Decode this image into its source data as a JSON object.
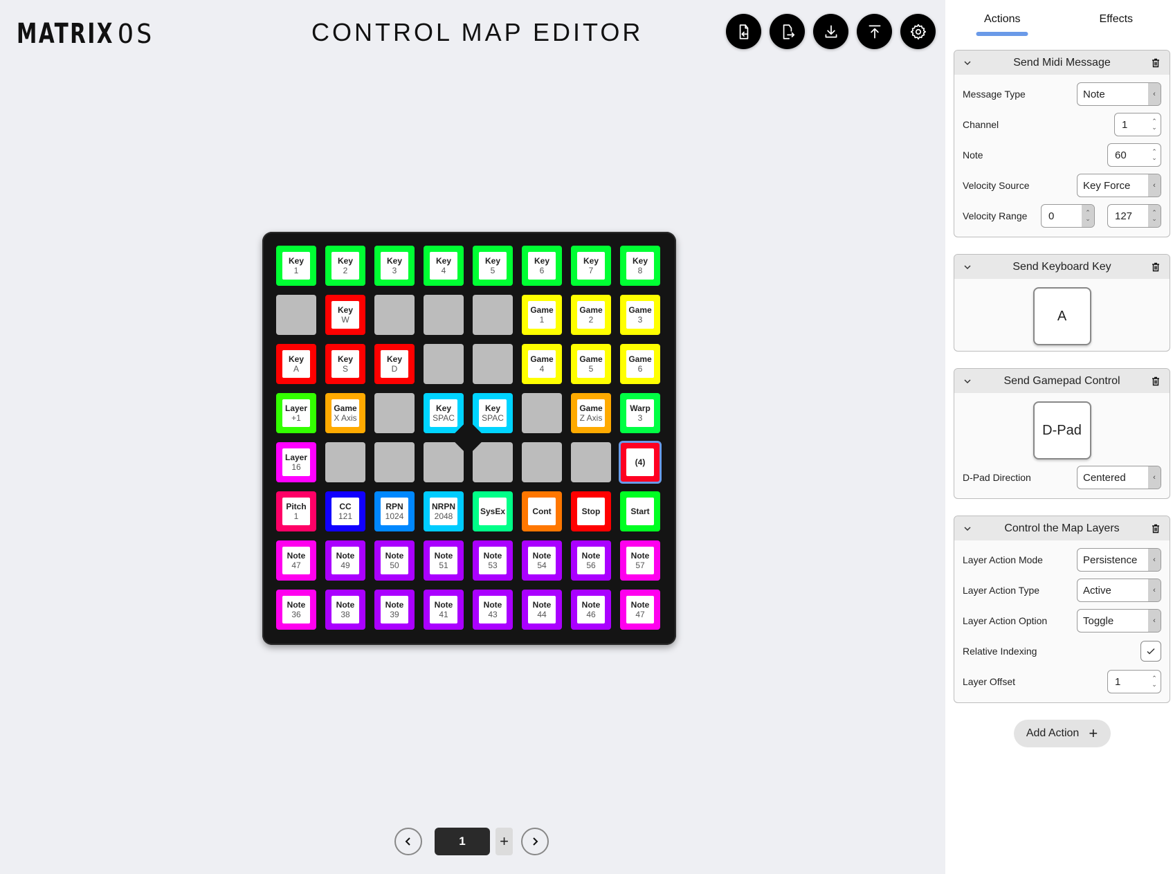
{
  "header": {
    "logo_bold": "MATRIX",
    "logo_thin": "OS",
    "title": "CONTROL MAP EDITOR",
    "toolbar": [
      {
        "name": "import-file-button",
        "icon": "file-import-icon"
      },
      {
        "name": "export-file-button",
        "icon": "file-export-icon"
      },
      {
        "name": "download-button",
        "icon": "download-icon"
      },
      {
        "name": "upload-button",
        "icon": "upload-icon"
      },
      {
        "name": "settings-button",
        "icon": "gear-icon"
      }
    ]
  },
  "grid": {
    "rows": [
      [
        {
          "l1": "Key",
          "l2": "1",
          "color": "#00ff33"
        },
        {
          "l1": "Key",
          "l2": "2",
          "color": "#00ff33"
        },
        {
          "l1": "Key",
          "l2": "3",
          "color": "#00ff33"
        },
        {
          "l1": "Key",
          "l2": "4",
          "color": "#00ff33"
        },
        {
          "l1": "Key",
          "l2": "5",
          "color": "#00ff33"
        },
        {
          "l1": "Key",
          "l2": "6",
          "color": "#00ff33"
        },
        {
          "l1": "Key",
          "l2": "7",
          "color": "#00ff33"
        },
        {
          "l1": "Key",
          "l2": "8",
          "color": "#00ff33"
        }
      ],
      [
        {
          "empty": true
        },
        {
          "l1": "Key",
          "l2": "W",
          "color": "#ff0000"
        },
        {
          "empty": true
        },
        {
          "empty": true
        },
        {
          "empty": true
        },
        {
          "l1": "Game",
          "l2": "1",
          "color": "#ffff00"
        },
        {
          "l1": "Game",
          "l2": "2",
          "color": "#ffff00"
        },
        {
          "l1": "Game",
          "l2": "3",
          "color": "#ffff00"
        }
      ],
      [
        {
          "l1": "Key",
          "l2": "A",
          "color": "#ff0000"
        },
        {
          "l1": "Key",
          "l2": "S",
          "color": "#ff0000"
        },
        {
          "l1": "Key",
          "l2": "D",
          "color": "#ff0000"
        },
        {
          "empty": true
        },
        {
          "empty": true
        },
        {
          "l1": "Game",
          "l2": "4",
          "color": "#ffff00"
        },
        {
          "l1": "Game",
          "l2": "5",
          "color": "#ffff00"
        },
        {
          "l1": "Game",
          "l2": "6",
          "color": "#ffff00"
        }
      ],
      [
        {
          "l1": "Layer",
          "l2": "+1",
          "color": "#33ff00"
        },
        {
          "l1": "Game",
          "l2": "X Axis",
          "color": "#ffaa00"
        },
        {
          "empty": true
        },
        {
          "l1": "Key",
          "l2": "SPAC",
          "color": "#00d4ff",
          "cut": "br"
        },
        {
          "l1": "Key",
          "l2": "SPAC",
          "color": "#00d4ff",
          "cut": "bl"
        },
        {
          "empty": true
        },
        {
          "l1": "Game",
          "l2": "Z Axis",
          "color": "#ffaa00"
        },
        {
          "l1": "Warp",
          "l2": "3",
          "color": "#00ff44"
        }
      ],
      [
        {
          "l1": "Layer",
          "l2": "16",
          "color": "#ff00ff"
        },
        {
          "empty": true
        },
        {
          "empty": true
        },
        {
          "empty": true,
          "cut": "tr"
        },
        {
          "empty": true,
          "cut": "tl"
        },
        {
          "empty": true
        },
        {
          "empty": true
        },
        {
          "l1": "(4)",
          "l2": "",
          "color": "#ff0022",
          "selected": true
        }
      ],
      [
        {
          "l1": "Pitch",
          "l2": "1",
          "color": "#ff0066"
        },
        {
          "l1": "CC",
          "l2": "121",
          "color": "#1100ff"
        },
        {
          "l1": "RPN",
          "l2": "1024",
          "color": "#0088ff"
        },
        {
          "l1": "NRPN",
          "l2": "2048",
          "color": "#00ccff"
        },
        {
          "l1": "SysEx",
          "l2": "",
          "color": "#00ff88"
        },
        {
          "l1": "Cont",
          "l2": "",
          "color": "#ff7700"
        },
        {
          "l1": "Stop",
          "l2": "",
          "color": "#ff0000"
        },
        {
          "l1": "Start",
          "l2": "",
          "color": "#00ff22"
        }
      ],
      [
        {
          "l1": "Note",
          "l2": "47",
          "color": "#ff00ee"
        },
        {
          "l1": "Note",
          "l2": "49",
          "color": "#aa00ff"
        },
        {
          "l1": "Note",
          "l2": "50",
          "color": "#aa00ff"
        },
        {
          "l1": "Note",
          "l2": "51",
          "color": "#aa00ff"
        },
        {
          "l1": "Note",
          "l2": "53",
          "color": "#aa00ff"
        },
        {
          "l1": "Note",
          "l2": "54",
          "color": "#aa00ff"
        },
        {
          "l1": "Note",
          "l2": "56",
          "color": "#aa00ff"
        },
        {
          "l1": "Note",
          "l2": "57",
          "color": "#ff00ee"
        }
      ],
      [
        {
          "l1": "Note",
          "l2": "36",
          "color": "#ff00ee"
        },
        {
          "l1": "Note",
          "l2": "38",
          "color": "#aa00ff"
        },
        {
          "l1": "Note",
          "l2": "39",
          "color": "#aa00ff"
        },
        {
          "l1": "Note",
          "l2": "41",
          "color": "#aa00ff"
        },
        {
          "l1": "Note",
          "l2": "43",
          "color": "#aa00ff"
        },
        {
          "l1": "Note",
          "l2": "44",
          "color": "#aa00ff"
        },
        {
          "l1": "Note",
          "l2": "46",
          "color": "#aa00ff"
        },
        {
          "l1": "Note",
          "l2": "47",
          "color": "#ff00ee"
        }
      ]
    ]
  },
  "pager": {
    "current": "1",
    "add_label": "+"
  },
  "panel": {
    "tabs": [
      {
        "label": "Actions",
        "active": true
      },
      {
        "label": "Effects",
        "active": false
      }
    ],
    "midi": {
      "title": "Send Midi Message",
      "message_type_label": "Message Type",
      "message_type_value": "Note",
      "channel_label": "Channel",
      "channel_value": "1",
      "note_label": "Note",
      "note_value": "60",
      "velocity_source_label": "Velocity Source",
      "velocity_source_value": "Key Force",
      "velocity_range_label": "Velocity Range",
      "velocity_min": "0",
      "velocity_max": "127"
    },
    "keyboard": {
      "title": "Send Keyboard Key",
      "key": "A"
    },
    "gamepad": {
      "title": "Send Gamepad Control",
      "control": "D-Pad",
      "direction_label": "D-Pad Direction",
      "direction_value": "Centered"
    },
    "layers": {
      "title": "Control the Map Layers",
      "mode_label": "Layer Action Mode",
      "mode_value": "Persistence",
      "type_label": "Layer Action Type",
      "type_value": "Active",
      "option_label": "Layer Action Option",
      "option_value": "Toggle",
      "relative_label": "Relative Indexing",
      "relative_checked": true,
      "offset_label": "Layer Offset",
      "offset_value": "1"
    },
    "add_action_label": "Add Action",
    "add_action_icon": "+"
  },
  "colors": {
    "accent": "#6a9ae8",
    "device_bg": "#141414",
    "empty_pad": "#bcbcbc"
  }
}
